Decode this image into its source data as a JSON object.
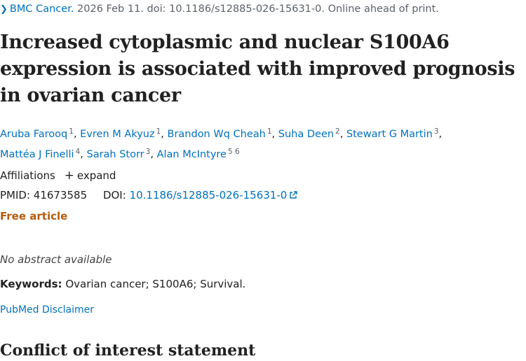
{
  "citation": {
    "journal": "BMC Cancer.",
    "details": "2026 Feb 11. doi: 10.1186/s12885-026-15631-0. Online ahead of print."
  },
  "title": "Increased cytoplasmic and nuclear S100A6 expression is associated with improved prognosis in ovarian cancer",
  "authors": [
    {
      "name": "Aruba Farooq",
      "aff": "1"
    },
    {
      "name": "Evren M Akyuz",
      "aff": "1"
    },
    {
      "name": "Brandon Wq Cheah",
      "aff": "1"
    },
    {
      "name": "Suha Deen",
      "aff": "2"
    },
    {
      "name": "Stewart G Martin",
      "aff": "3"
    },
    {
      "name": "Mattéa J Finelli",
      "aff": "4"
    },
    {
      "name": "Sarah Storr",
      "aff": "3"
    },
    {
      "name": "Alan McIntyre",
      "aff": "5 6"
    }
  ],
  "affiliations": {
    "label": "Affiliations",
    "expand": "expand"
  },
  "ids": {
    "pmid_label": "PMID:",
    "pmid": "41673585",
    "doi_label": "DOI:",
    "doi": "10.1186/s12885-026-15631-0"
  },
  "free_article": "Free article",
  "no_abstract": "No abstract available",
  "keywords": {
    "label": "Keywords:",
    "text": "Ovarian cancer; S100A6; Survival."
  },
  "disclaimer": "PubMed Disclaimer",
  "conflict_heading": "Conflict of interest statement",
  "icons": {
    "chevron": "chevron-right-icon",
    "plus": "plus-icon",
    "external": "external-link-icon"
  },
  "colors": {
    "link": "#0071bc",
    "free": "#b65c10",
    "text": "#212121"
  }
}
